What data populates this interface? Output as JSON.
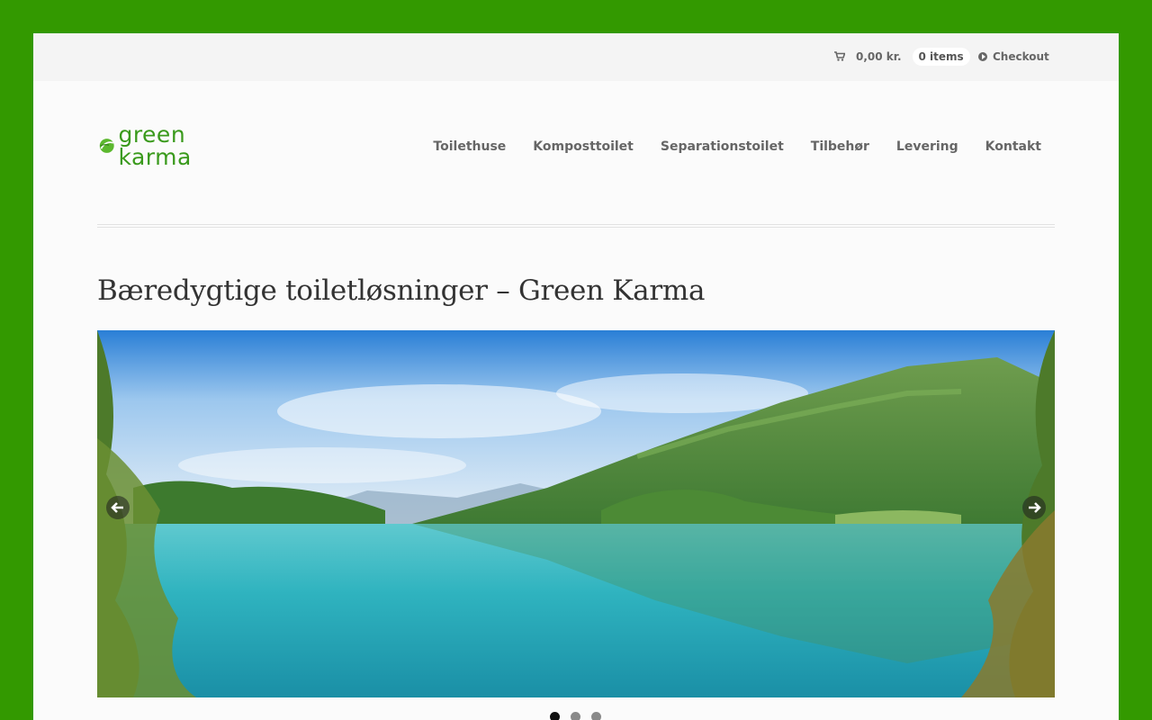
{
  "header": {
    "cart_total": "0,00 kr.",
    "cart_items": "0 items",
    "checkout_label": "Checkout"
  },
  "logo": {
    "text": "green karma"
  },
  "nav": {
    "items": [
      {
        "label": "Toilethuse"
      },
      {
        "label": "Komposttoilet"
      },
      {
        "label": "Separationstoilet"
      },
      {
        "label": "Tilbehør"
      },
      {
        "label": "Levering"
      },
      {
        "label": "Kontakt"
      }
    ]
  },
  "main": {
    "title": "Bæredygtige toiletløsninger – Green Karma"
  },
  "slider": {
    "image_subject": "mountain lake landscape",
    "slide_count": 3,
    "active_slide": 1
  },
  "colors": {
    "background": "#339900",
    "logo_green": "#3a9a1c",
    "text_gray": "#666666"
  }
}
